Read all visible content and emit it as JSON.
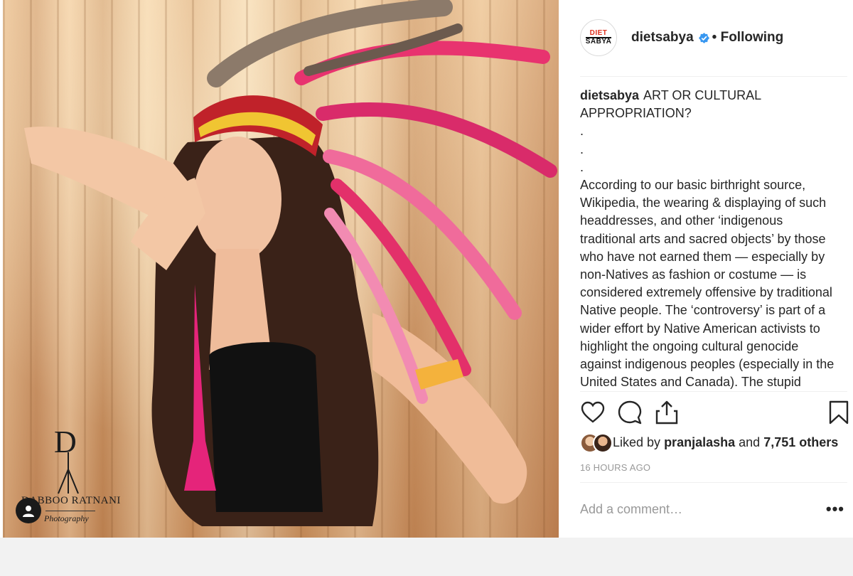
{
  "post": {
    "username": "dietsabya",
    "follow_status": "• Following",
    "logo_text_top": "DIET",
    "logo_text_bottom": "SABYA",
    "caption_title": "ART OR CULTURAL APPROPRIATION?",
    "caption_dots": [
      ".",
      ".",
      "."
    ],
    "caption_body": "According to our basic birthright source, Wikipedia, the wearing & displaying of such headdresses, and other ‘indigenous traditional arts and sacred objects’ by those who have not earned them — especially by non-Natives as fashion or costume — is considered extremely offensive by traditional Native people. The ‘controversy’ is part of a wider effort by Native American activists to highlight the ongoing cultural genocide against indigenous peoples (especially in the United States and Canada). The stupid",
    "liked_prefix": "Liked by",
    "liked_user": "pranjalasha",
    "liked_and": "and",
    "liked_others": "7,751 others",
    "time_ago": "16 HOURS AGO",
    "comment_placeholder": "Add a comment…",
    "more_label": "•••"
  },
  "watermark": {
    "letter": "D",
    "name": "DABBOO RATNANI",
    "subtitle": "Photography"
  },
  "icons": {
    "verified": "verified-badge-icon",
    "like": "heart-icon",
    "comment": "comment-bubble-icon",
    "share": "share-icon",
    "save": "bookmark-icon",
    "user": "user-icon"
  },
  "colors": {
    "verified_blue": "#3897f0",
    "text": "#262626",
    "muted": "#999999",
    "logo_red": "#e0301e"
  }
}
